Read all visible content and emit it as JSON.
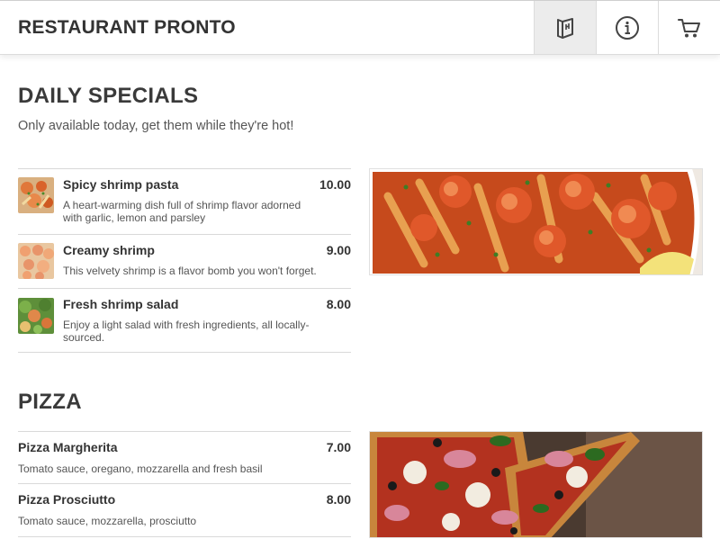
{
  "header": {
    "title": "RESTAURANT PRONTO",
    "buttons": [
      {
        "icon": "menu-book-icon",
        "active": true
      },
      {
        "icon": "info-icon",
        "active": false
      },
      {
        "icon": "cart-icon",
        "active": false
      }
    ]
  },
  "specials": {
    "title": "DAILY SPECIALS",
    "subtitle": "Only available today, get them while they're hot!",
    "items": [
      {
        "name": "Spicy shrimp pasta",
        "price": "10.00",
        "desc": "A heart-warming dish full of shrimp flavor adorned with garlic, lemon and parsley"
      },
      {
        "name": "Creamy shrimp",
        "price": "9.00",
        "desc": "This velvety shrimp is a flavor bomb you won't forget."
      },
      {
        "name": "Fresh shrimp salad",
        "price": "8.00",
        "desc": "Enjoy a light salad with fresh ingredients, all locally-sourced."
      }
    ]
  },
  "pizza": {
    "title": "PIZZA",
    "items": [
      {
        "name": "Pizza Margherita",
        "price": "7.00",
        "desc": "Tomato sauce, oregano, mozzarella and fresh basil"
      },
      {
        "name": "Pizza Prosciutto",
        "price": "8.00",
        "desc": "Tomato sauce, mozzarella, prosciutto"
      }
    ]
  },
  "colors": {
    "text": "#333333",
    "active_tab": "#ececec",
    "divider": "#d9d9d9"
  }
}
